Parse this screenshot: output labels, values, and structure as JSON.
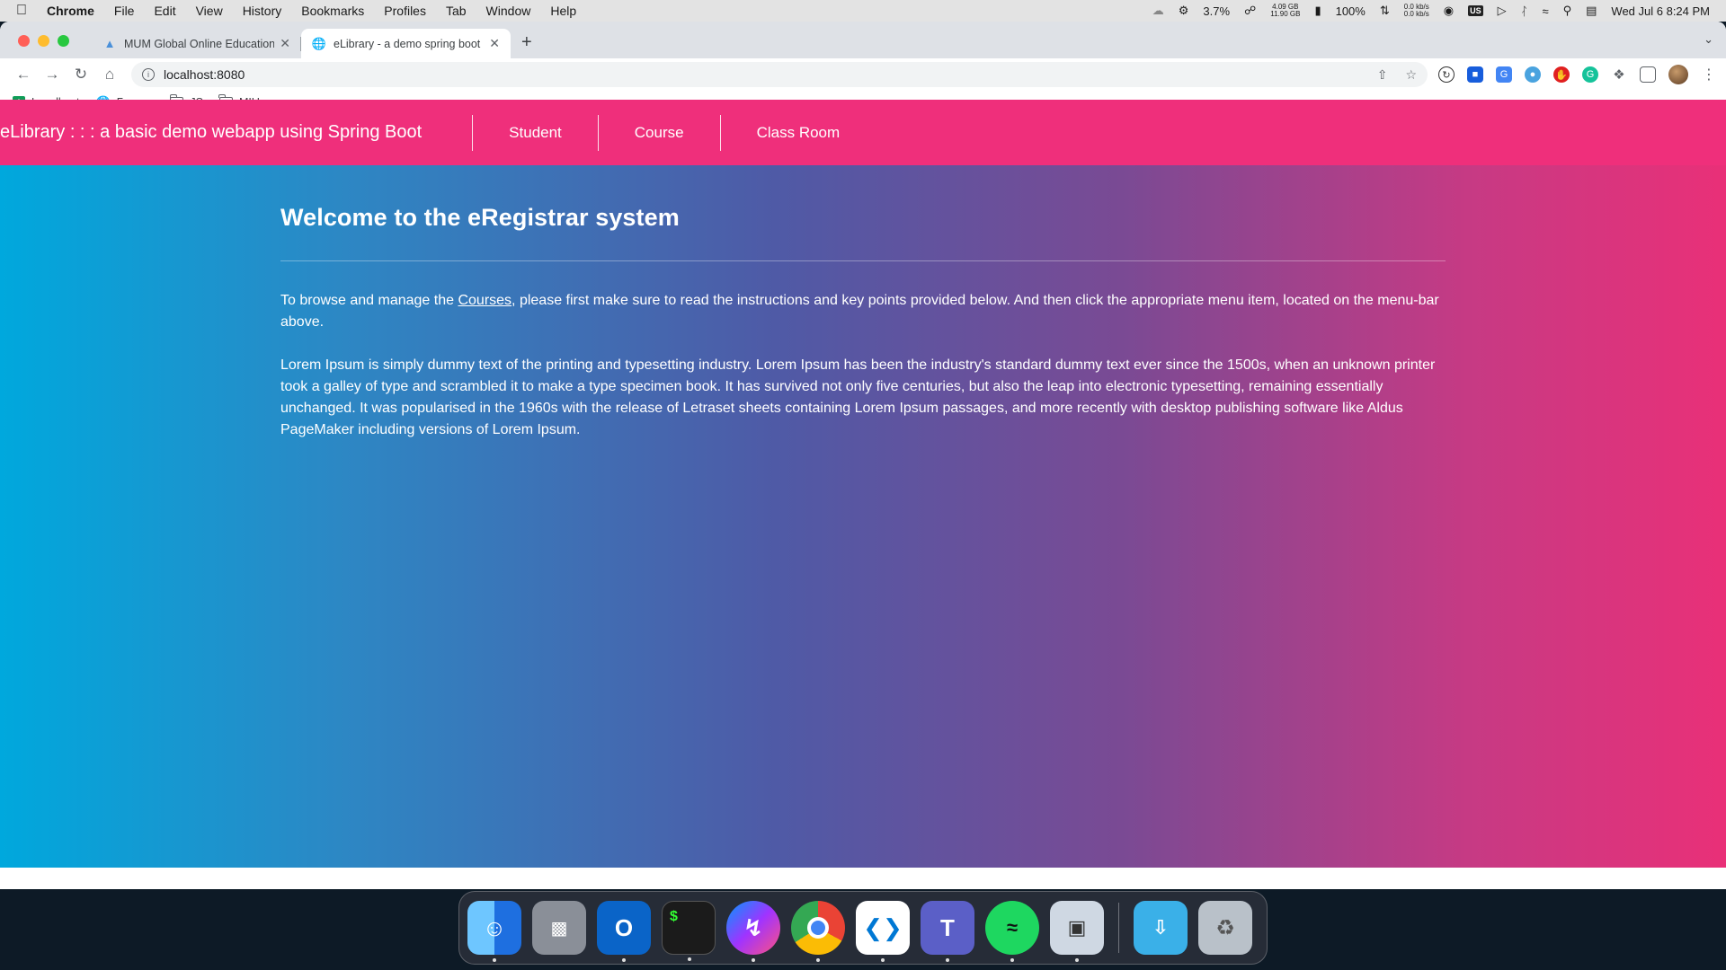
{
  "menubar": {
    "app_name": "Chrome",
    "menus": [
      "File",
      "Edit",
      "View",
      "History",
      "Bookmarks",
      "Profiles",
      "Tab",
      "Window",
      "Help"
    ],
    "cpu": "3.7%",
    "mem_top": "4.09 GB",
    "mem_bottom": "11.90 GB",
    "battery": "100%",
    "net_up": "0.0 kb/s",
    "net_down": "0.0 kb/s",
    "keyboard": "US",
    "datetime": "Wed Jul 6  8:24 PM"
  },
  "browser": {
    "tabs": [
      {
        "title": "MUM Global Online Education",
        "active": false,
        "icon": "graduation-icon"
      },
      {
        "title": "eLibrary - a demo spring boot",
        "active": true,
        "icon": "globe-icon"
      }
    ],
    "url": "localhost:8080",
    "bookmarks": [
      {
        "label": "Localhost",
        "icon": "plus-square-icon"
      },
      {
        "label": "Бичвэр",
        "icon": "globe-icon"
      },
      {
        "label": "JS",
        "icon": "folder-icon"
      },
      {
        "label": "MIU",
        "icon": "folder-icon"
      }
    ]
  },
  "site": {
    "brand": "eLibrary : : : a basic demo webapp using Spring Boot",
    "nav": [
      "Student",
      "Course",
      "Class Room"
    ],
    "heading": "Welcome to the eRegistrar system",
    "intro_before": "To browse and manage the ",
    "intro_link": "Courses",
    "intro_after": ", please first make sure to read the instructions and key points provided below. And then click the appropriate menu item, located on the menu-bar above.",
    "lorem": "Lorem Ipsum is simply dummy text of the printing and typesetting industry. Lorem Ipsum has been the industry's standard dummy text ever since the 1500s, when an unknown printer took a galley of type and scrambled it to make a type specimen book. It has survived not only five centuries, but also the leap into electronic typesetting, remaining essentially unchanged. It was popularised in the 1960s with the release of Letraset sheets containing Lorem Ipsum passages, and more recently with desktop publishing software like Aldus PageMaker including versions of Lorem Ipsum."
  },
  "dock": [
    {
      "name": "finder",
      "color": "#3a8ef0"
    },
    {
      "name": "launchpad",
      "color": "#8a8f98"
    },
    {
      "name": "outlook",
      "color": "#0a64c8"
    },
    {
      "name": "terminal",
      "color": "#1b1b1b"
    },
    {
      "name": "messenger",
      "color": "#8b3df2"
    },
    {
      "name": "chrome",
      "color": "#ffffff"
    },
    {
      "name": "vscode",
      "color": "#ffffff"
    },
    {
      "name": "teams",
      "color": "#5b5fc7"
    },
    {
      "name": "spotify",
      "color": "#1ed760"
    },
    {
      "name": "preview",
      "color": "#cfd8e3"
    },
    {
      "name": "downloads",
      "color": "#3ab0e8"
    },
    {
      "name": "trash",
      "color": "#b9c1c9"
    }
  ]
}
